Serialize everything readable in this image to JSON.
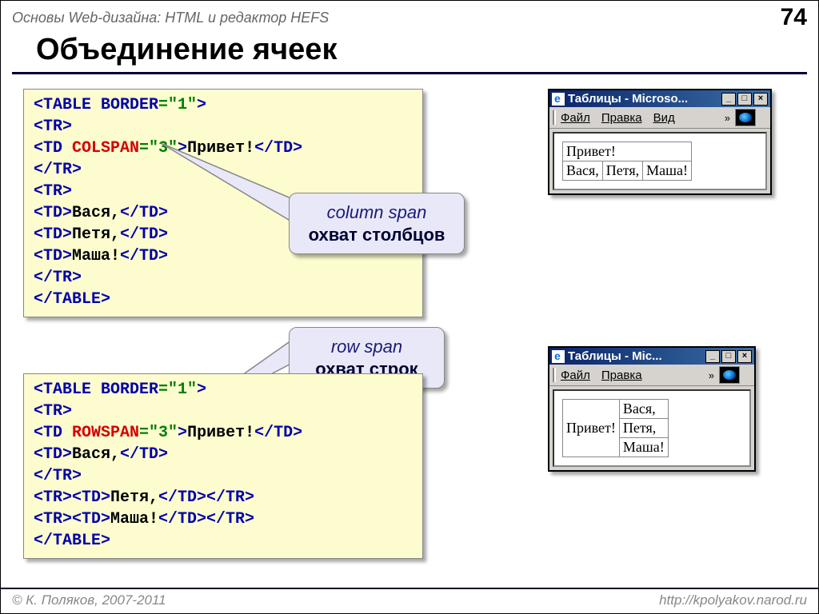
{
  "header": {
    "course": "Основы Web-дизайна: HTML и редактор HEFS",
    "page": "74"
  },
  "title": "Объединение ячеек",
  "code1": {
    "l1a": "<TABLE ",
    "l1b": "BORDER",
    "l1c": "=\"1\"",
    "l1d": ">",
    "l2": "<TR>",
    "l3a": "   <TD ",
    "l3b": "COLSPAN",
    "l3c": "=\"3\"",
    "l3d": ">",
    "l3e": "Привет!",
    "l3f": "</TD>",
    "l4": "</TR>",
    "l5": "<TR>",
    "l6a": "   <TD>",
    "l6b": "Вася,",
    "l6c": "</TD>",
    "l7a": "   <TD>",
    "l7b": "Петя,",
    "l7c": "</TD>",
    "l8a": "   <TD>",
    "l8b": "Маша!",
    "l8c": "</TD>",
    "l9": "</TR>",
    "l10": "</TABLE>"
  },
  "code2": {
    "l1a": "<TABLE ",
    "l1b": "BORDER",
    "l1c": "=\"1\"",
    "l1d": ">",
    "l2": "<TR>",
    "l3a": "   <TD ",
    "l3b": "ROWSPAN",
    "l3c": "=\"3\"",
    "l3d": ">",
    "l3e": "Привет!",
    "l3f": "</TD>",
    "l4a": "   <TD>",
    "l4b": "Вася,",
    "l4c": "</TD>",
    "l5": "</TR>",
    "l6a": "<TR><TD>",
    "l6b": "Петя,",
    "l6c": "</TD></TR>",
    "l7a": "<TR><TD>",
    "l7b": "Маша!",
    "l7c": "</TD></TR>",
    "l8": "</TABLE>"
  },
  "callout1": {
    "line1": "column span",
    "line2": "охват столбцов"
  },
  "callout2": {
    "line1": "row span",
    "line2": "охват строк"
  },
  "browser1": {
    "title": "Таблицы - Microso...",
    "menu": {
      "file": "Файл",
      "edit": "Правка",
      "view": "Вид"
    },
    "table": {
      "r1c1": "Привет!",
      "r2c1": "Вася,",
      "r2c2": "Петя,",
      "r2c3": "Маша!"
    }
  },
  "browser2": {
    "title": "Таблицы - Mic...",
    "menu": {
      "file": "Файл",
      "edit": "Правка"
    },
    "table": {
      "c1": "Привет!",
      "r1": "Вася,",
      "r2": "Петя,",
      "r3": "Маша!"
    }
  },
  "footer": {
    "copyright": "© К. Поляков, 2007-2011",
    "url": "http://kpolyakov.narod.ru"
  }
}
